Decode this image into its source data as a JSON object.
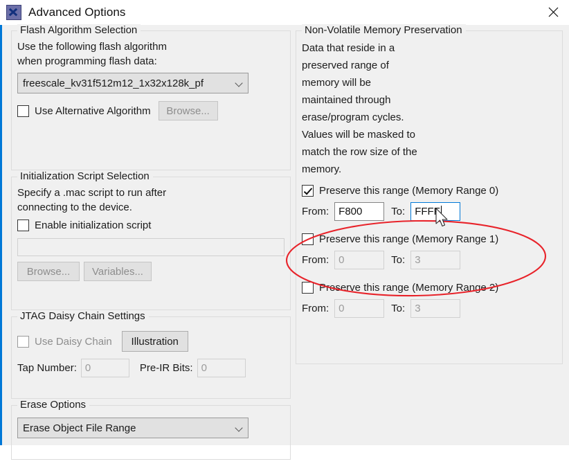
{
  "window": {
    "title": "Advanced Options",
    "icon": "x-app-icon",
    "close_label": "Close",
    "accent_color": "#0078d7",
    "background_color": "#f0f0f0"
  },
  "left_column": {
    "flash_algorithm": {
      "legend": "Flash Algorithm Selection",
      "description_lines": [
        "Use the following flash algorithm",
        "when programming flash data:"
      ],
      "algorithm_combo_value": "freescale_kv31f512m12_1x32x128k_pf",
      "use_alternative_checkbox": {
        "label": "Use Alternative Algorithm",
        "checked": false
      },
      "browse_button": "Browse..."
    },
    "init_script": {
      "legend": "Initialization Script Selection",
      "description_lines": [
        "Specify a .mac script to run after",
        "connecting to the device."
      ],
      "enable_checkbox": {
        "label": "Enable initialization script",
        "checked": false
      },
      "script_path_value": "",
      "script_path_placeholder": "",
      "browse_button": "Browse...",
      "variables_button": "Variables..."
    },
    "jtag": {
      "legend": "JTAG Daisy Chain Settings",
      "use_daisy_chain_checkbox": {
        "label": "Use Daisy Chain",
        "checked": false
      },
      "illustration_button": "Illustration",
      "tap_number_label": "Tap Number:",
      "tap_number_value": "0",
      "pre_ir_bits_label": "Pre-IR Bits:",
      "pre_ir_bits_value": "0"
    },
    "erase": {
      "legend": "Erase Options",
      "erase_combo_value": "Erase Object File Range"
    }
  },
  "right_column": {
    "nvm": {
      "legend": "Non-Volatile Memory Preservation",
      "description_lines": [
        "Data that reside in a",
        "preserved range of",
        "memory will be",
        "maintained through",
        "erase/program cycles.",
        "Values will be masked to",
        "match the row size of the",
        "memory."
      ],
      "from_label": "From:",
      "to_label": "To:",
      "ranges": [
        {
          "label": "Preserve this range (Memory Range 0)",
          "checked": true,
          "from_value": "F800",
          "to_value": "FFFF",
          "to_focused": true,
          "enabled": true
        },
        {
          "label": "Preserve this range (Memory Range 1)",
          "checked": false,
          "from_value": "0",
          "to_value": "3",
          "to_focused": false,
          "enabled": false
        },
        {
          "label": "Preserve this range (Memory Range 2)",
          "checked": false,
          "from_value": "0",
          "to_value": "3",
          "to_focused": false,
          "enabled": false
        }
      ]
    }
  },
  "annotation": {
    "type": "ellipse-highlight",
    "color": "#e8232a",
    "target": "Memory Range 0 preserve row"
  }
}
